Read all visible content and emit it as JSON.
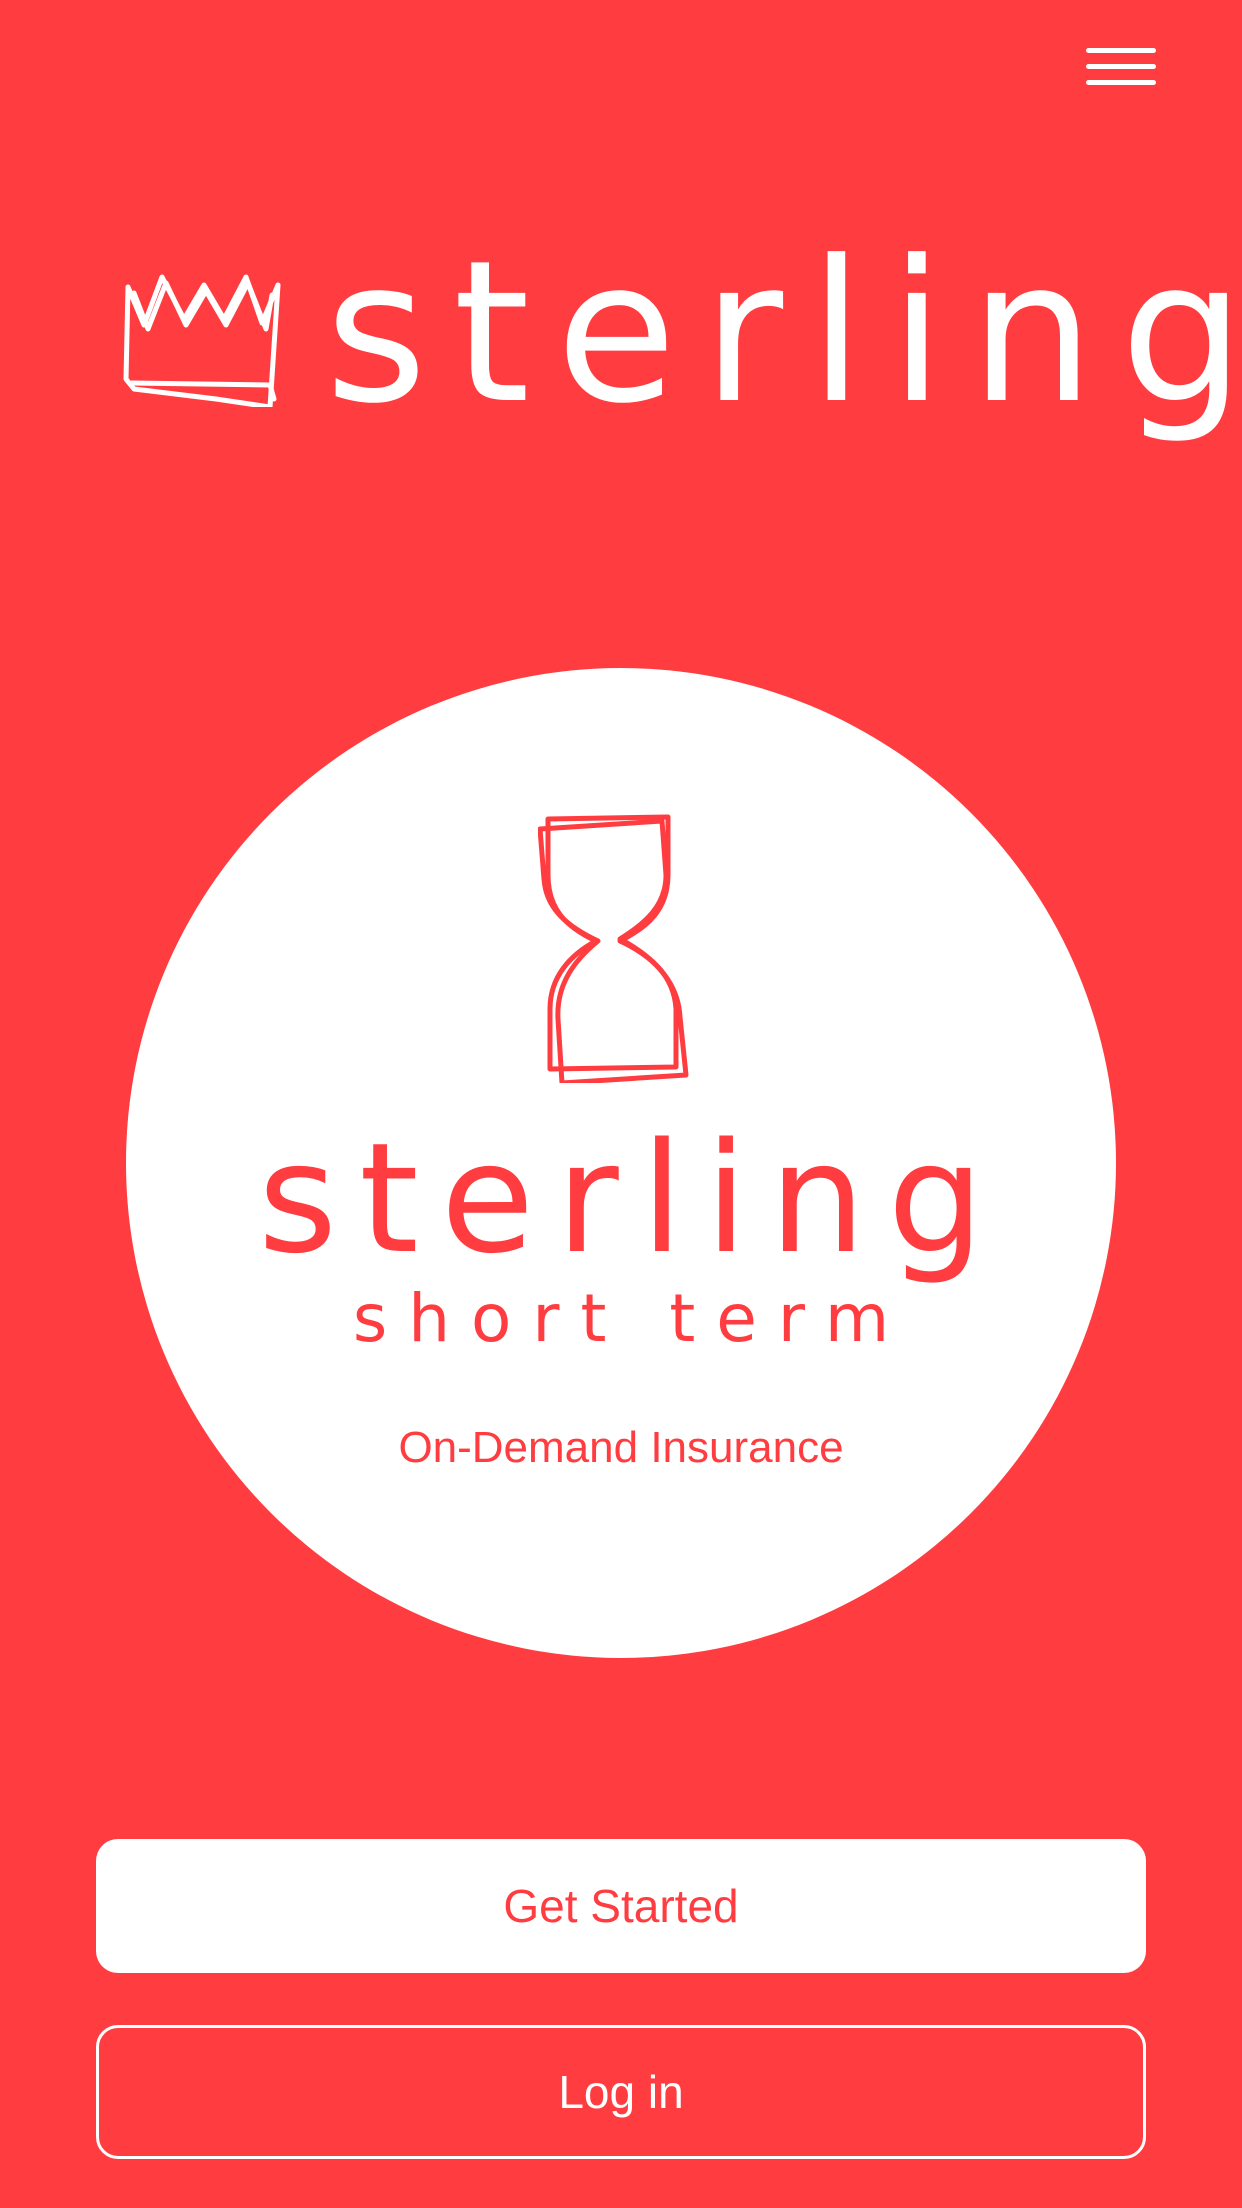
{
  "header": {
    "brand_name": "sterling",
    "menu_icon": "hamburger-menu-icon",
    "crown_icon": "crown-icon"
  },
  "hero": {
    "icon": "hourglass-icon",
    "product_name": "sterling",
    "product_subtitle": "short term",
    "tagline": "On-Demand Insurance"
  },
  "actions": {
    "get_started_label": "Get Started",
    "login_label": "Log in"
  },
  "colors": {
    "brand_red": "#FF3D41",
    "white": "#FFFFFF"
  }
}
